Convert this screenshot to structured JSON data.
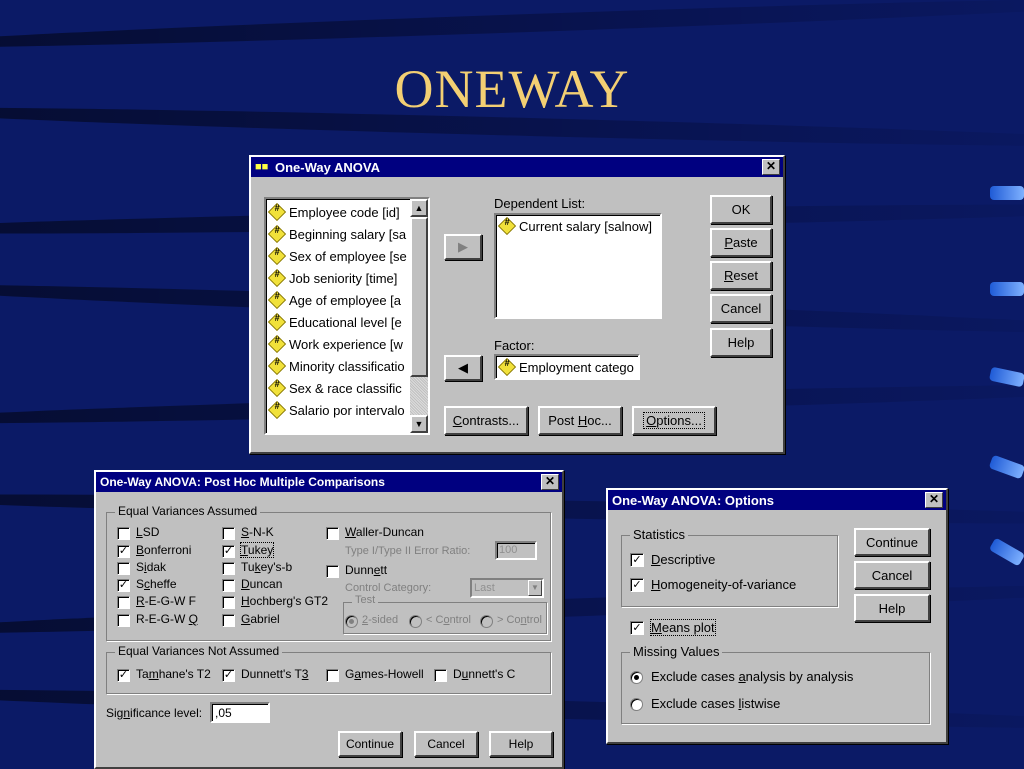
{
  "slide": {
    "title": "ONEWAY"
  },
  "main_dialog": {
    "title": "One-Way ANOVA",
    "variables": [
      "Employee code [id]",
      "Beginning salary [sa",
      "Sex of employee [se",
      "Job seniority [time]",
      "Age of employee [a",
      "Educational level [e",
      "Work experience [w",
      "Minority classificatio",
      "Sex & race classific",
      "Salario por intervalo"
    ],
    "dependent_label": "Dependent List:",
    "dependent_items": [
      "Current salary [salnow]"
    ],
    "factor_label": "Factor:",
    "factor_value": "Employment catego",
    "buttons": {
      "ok": "OK",
      "paste": "Paste",
      "reset": "Reset",
      "cancel": "Cancel",
      "help": "Help"
    },
    "bottom_buttons": {
      "contrasts": "Contrasts...",
      "post_hoc": "Post Hoc...",
      "options": "Options..."
    }
  },
  "posthoc_dialog": {
    "title": "One-Way ANOVA: Post Hoc Multiple Comparisons",
    "equal_group": "Equal Variances Assumed",
    "col1": [
      {
        "label": "LSD",
        "checked": false
      },
      {
        "label": "Bonferroni",
        "checked": true
      },
      {
        "label": "Sidak",
        "checked": false
      },
      {
        "label": "Scheffe",
        "checked": true
      },
      {
        "label": "R-E-G-W F",
        "checked": false
      },
      {
        "label": "R-E-G-W Q",
        "checked": false
      }
    ],
    "col2": [
      {
        "label": "S-N-K",
        "checked": false
      },
      {
        "label": "Tukey",
        "checked": true
      },
      {
        "label": "Tukey's-b",
        "checked": false
      },
      {
        "label": "Duncan",
        "checked": false
      },
      {
        "label": "Hochberg's GT2",
        "checked": false
      },
      {
        "label": "Gabriel",
        "checked": false
      }
    ],
    "waller": {
      "label": "Waller-Duncan",
      "checked": false
    },
    "ratio_label": "Type I/Type II Error Ratio:",
    "ratio_value": "100",
    "dunnett": {
      "label": "Dunnett",
      "checked": false
    },
    "control_label": "Control Category:",
    "control_value": "Last",
    "test_legend": "Test",
    "test_options": [
      "2-sided",
      "< Control",
      "> Control"
    ],
    "test_selected": 0,
    "unequal_group": "Equal Variances Not Assumed",
    "unequal": [
      {
        "label": "Tamhane's T2",
        "checked": true
      },
      {
        "label": "Dunnett's T3",
        "checked": true
      },
      {
        "label": "Games-Howell",
        "checked": false
      },
      {
        "label": "Dunnett's C",
        "checked": false
      }
    ],
    "sig_label": "Significance level:",
    "sig_value": ",05",
    "buttons": {
      "continue": "Continue",
      "cancel": "Cancel",
      "help": "Help"
    }
  },
  "options_dialog": {
    "title": "One-Way ANOVA: Options",
    "statistics_legend": "Statistics",
    "descriptive": {
      "label": "Descriptive",
      "checked": true
    },
    "homogeneity": {
      "label": "Homogeneity-of-variance",
      "checked": true
    },
    "means_plot": {
      "label": "Means plot",
      "checked": true
    },
    "missing_legend": "Missing Values",
    "missing_options": [
      "Exclude cases analysis by analysis",
      "Exclude cases listwise"
    ],
    "missing_selected": 0,
    "buttons": {
      "continue": "Continue",
      "cancel": "Cancel",
      "help": "Help"
    }
  }
}
